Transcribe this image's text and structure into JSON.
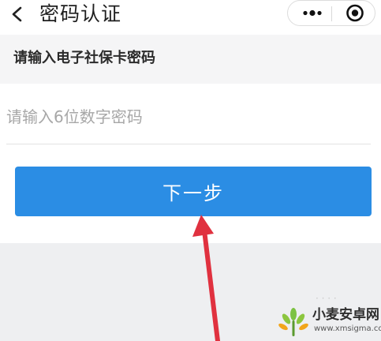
{
  "header": {
    "title": "密码认证",
    "back_icon": "chevron-left-icon",
    "more_icon": "more-dots-icon",
    "close_icon": "close-target-icon"
  },
  "form": {
    "section_label": "请输入电子社保卡密码",
    "password_value": "",
    "password_placeholder": "请输入6位数字密码",
    "next_button_label": "下一步"
  },
  "annotation": {
    "arrow_color": "#e0313f"
  },
  "watermark": {
    "name": "小麦安卓网",
    "url": "www.xmsigma.com"
  },
  "colors": {
    "accent": "#2b8de4",
    "background": "#eeeff1"
  }
}
